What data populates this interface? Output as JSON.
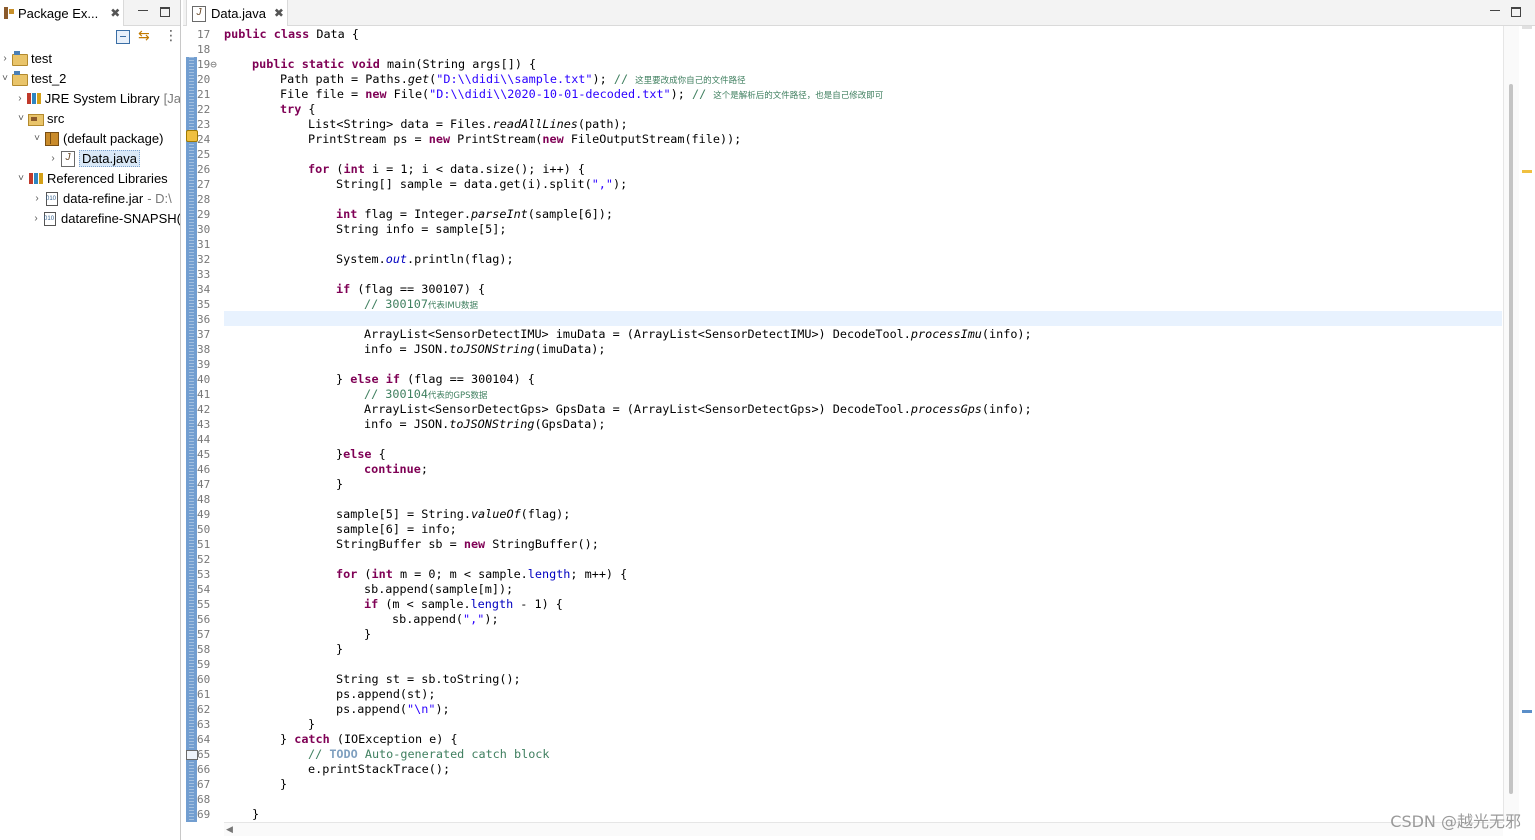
{
  "package_explorer": {
    "tab_label": "Package Ex...",
    "close_glyph": "✖",
    "tree": [
      {
        "label": "test",
        "extra": "",
        "arrow": "›"
      },
      {
        "label": "test_2",
        "extra": "",
        "arrow": "˅"
      },
      {
        "label": "JRE System Library",
        "extra": "[Ja",
        "arrow": "›"
      },
      {
        "label": "src",
        "extra": "",
        "arrow": "˅"
      },
      {
        "label": "(default package)",
        "extra": "",
        "arrow": "˅"
      },
      {
        "label": "Data.java",
        "extra": "",
        "arrow": "›"
      },
      {
        "label": "Referenced Libraries",
        "extra": "",
        "arrow": "˅"
      },
      {
        "label": "data-refine.jar",
        "extra": "- D:\\",
        "arrow": "›"
      },
      {
        "label": "datarefine-SNAPSH(",
        "extra": "",
        "arrow": "›"
      }
    ]
  },
  "editor": {
    "tab_label": "Data.java",
    "close_glyph": "✖",
    "line_numbers": [
      "17",
      "18",
      "19⊖",
      "20",
      "21",
      "22",
      "23",
      "24",
      "25",
      "26",
      "27",
      "28",
      "29",
      "30",
      "31",
      "32",
      "33",
      "34",
      "35",
      "36",
      "37",
      "38",
      "39",
      "40",
      "41",
      "42",
      "43",
      "44",
      "45",
      "46",
      "47",
      "48",
      "49",
      "50",
      "51",
      "52",
      "53",
      "54",
      "55",
      "56",
      "57",
      "58",
      "59",
      "60",
      "61",
      "62",
      "63",
      "64",
      "65",
      "66",
      "67",
      "68",
      "69"
    ],
    "text": {
      "public": "public",
      "class": "class",
      "static": "static",
      "void": "void",
      "new": "new",
      "try": "try",
      "for": "for",
      "int": "int",
      "if": "if",
      "else": "else",
      "continue": "continue",
      "catch": "catch",
      "todo": "TODO",
      "l17_rest": " Data {",
      "l19_rest": " main(String args[]) {",
      "l20_a": "Path path = Paths.",
      "l20_m": "get",
      "l20_b": "(",
      "l20_str": "\"D:\\\\didi\\\\sample.txt\"",
      "l20_c": "); ",
      "l20_cm": "// ",
      "l20_cmsmall": "这里要改成你自己的文件路径",
      "l21_a": "File file = ",
      "l21_b": " File(",
      "l21_str": "\"D:\\\\didi\\\\2020-10-01-decoded.txt\"",
      "l21_c": "); ",
      "l21_cm": "// ",
      "l21_cmsmall": "这个是解析后的文件路径，也是自己修改即可",
      "l22_rest": " {",
      "l23_a": "List<String> data = Files.",
      "l23_m": "readAllLines",
      "l23_b": "(path);",
      "l24_a": "PrintStream ps = ",
      "l24_b": " PrintStream(",
      "l24_c": " FileOutputStream(file));",
      "l26_a": " (",
      "l26_b": " i = 1; i < data.size(); i++) {",
      "l27": "String[] sample = data.get(i).split(",
      "l27_str": "\",\"",
      "l27_c": ");",
      "l29_a": " flag = Integer.",
      "l29_m": "parseInt",
      "l29_b": "(sample[6]);",
      "l30": "String info = sample[5];",
      "l32_a": "System.",
      "l32_f": "out",
      "l32_b": ".println(flag);",
      "l34_rest": " (flag == 300107) {",
      "l35_cm": "// 300107",
      "l35_cmsmall": "代表IMU数据",
      "l37_a": "ArrayList<SensorDetectIMU> imuData = (ArrayList<SensorDetectIMU>) DecodeTool.",
      "l37_m": "processImu",
      "l37_b": "(info);",
      "l38_a": "info = JSON.",
      "l38_m": "toJSONString",
      "l38_b": "(imuData);",
      "l40_a": "} ",
      "l40_b": " (flag == 300104) {",
      "l41_cm": "// 300104",
      "l41_cmsmall": "代表的GPS数据",
      "l42_a": "ArrayList<SensorDetectGps> GpsData = (ArrayList<SensorDetectGps>) DecodeTool.",
      "l42_m": "processGps",
      "l42_b": "(info);",
      "l43_a": "info = JSON.",
      "l43_m": "toJSONString",
      "l43_b": "(GpsData);",
      "l45_a": "}",
      "l45_b": " {",
      "l46_b": ";",
      "close_brace": "}",
      "l49_a": "sample[5] = String.",
      "l49_m": "valueOf",
      "l49_b": "(flag);",
      "l50": "sample[6] = info;",
      "l51_a": "StringBuffer sb = ",
      "l51_b": " StringBuffer();",
      "l53_b": " m = 0; m < sample.",
      "l53_f": "length",
      "l53_c": "; m++) {",
      "l54": "sb.append(sample[m]);",
      "l55_a": " (m < sample.",
      "l55_f": "length",
      "l55_b": " - 1) {",
      "l56_a": "sb.append(",
      "l56_str": "\",\"",
      "l56_b": ");",
      "l60": "String st = sb.toString();",
      "l61": "ps.append(st);",
      "l62_a": "ps.append(",
      "l62_str": "\"\\n\"",
      "l62_b": ");",
      "l64_a": "} ",
      "l64_b": " (IOException e) {",
      "l65_cm": "// ",
      "l65_rest": " Auto-generated catch block",
      "l66": "e.printStackTrace();"
    }
  },
  "watermark": "CSDN @越光无邪",
  "colors": {
    "keyword": "#7f0055",
    "string": "#2a00ff",
    "comment": "#3f7f5f",
    "field": "#0000c0",
    "current_line": "#e8f2fe"
  }
}
